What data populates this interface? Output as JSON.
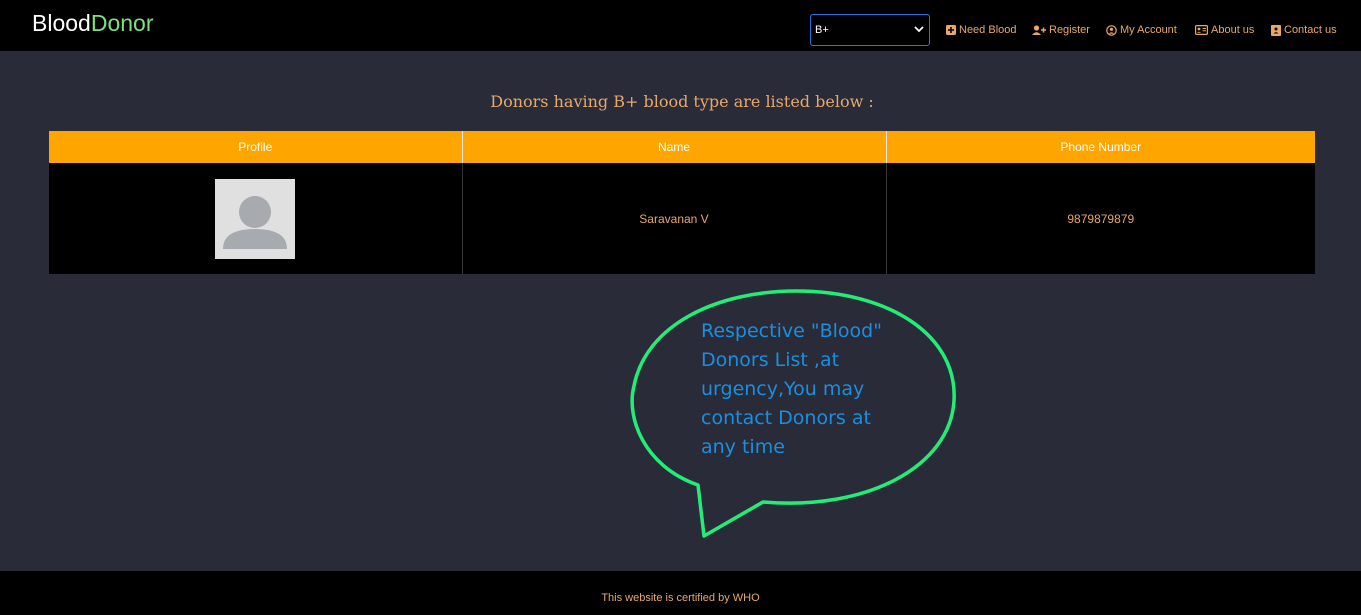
{
  "brand": {
    "part1": "Blood",
    "part2": "Donor"
  },
  "blood_select": {
    "value": "B+"
  },
  "nav": [
    {
      "label": "Need Blood",
      "icon": "plus-square-icon"
    },
    {
      "label": "Register",
      "icon": "user-plus-icon"
    },
    {
      "label": "My Account",
      "icon": "user-circle-icon"
    },
    {
      "label": "About us",
      "icon": "id-card-icon"
    },
    {
      "label": "Contact us",
      "icon": "contact-book-icon"
    }
  ],
  "heading": "Donors having B+ blood type are listed below :",
  "table": {
    "headers": [
      "Profile",
      "Name",
      "Phone Number"
    ],
    "rows": [
      {
        "name": "Saravanan V",
        "phone": "9879879879"
      }
    ]
  },
  "annotation": "Respective \"Blood\"\nDonors List ,at\nurgency,You may\ncontact Donors at\nany time",
  "footer": "This website is certified by WHO",
  "colors": {
    "accent": "#ffa500",
    "text": "#e8a86a",
    "brand_green": "#7ee07e",
    "bubble": "#22ee77",
    "background": "#2a2b38"
  }
}
